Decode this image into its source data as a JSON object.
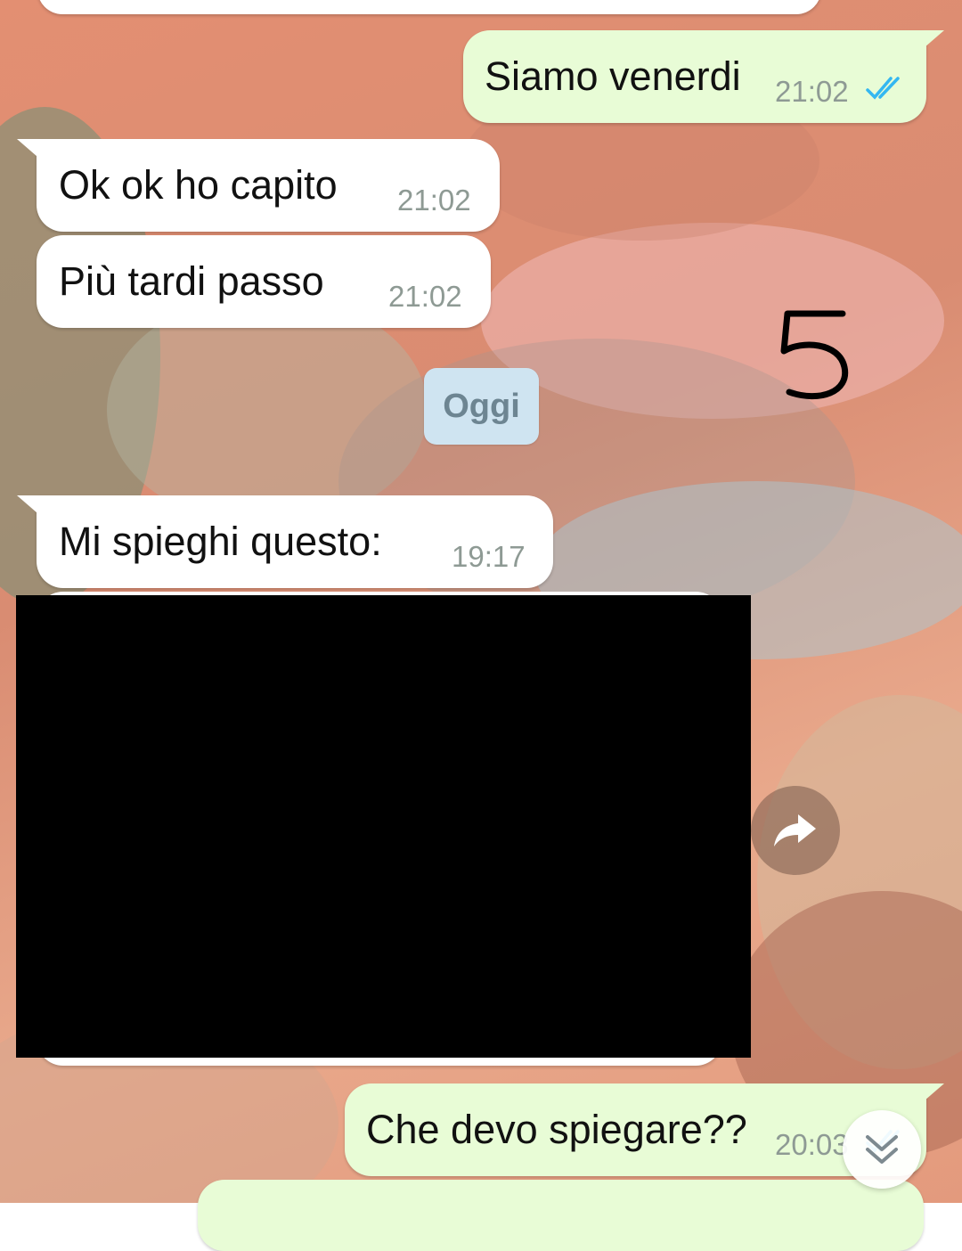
{
  "wallpaper": {
    "description": "abstract painted pattern"
  },
  "annotation": {
    "text": "5"
  },
  "messages": [
    {
      "direction": "outgoing",
      "text": "Siamo venerdi",
      "time": "21:02",
      "status": "read"
    },
    {
      "direction": "incoming",
      "text": "Ok ok ho capito",
      "time": "21:02"
    },
    {
      "direction": "incoming",
      "text": "Più tardi passo",
      "time": "21:02"
    },
    {
      "direction": "incoming",
      "text": "Mi spieghi questo:",
      "time": "19:17"
    },
    {
      "direction": "outgoing",
      "text": "Che devo spiegare??",
      "time": "20:03",
      "status": "read"
    }
  ],
  "date_separator": {
    "label": "Oggi"
  },
  "media": {
    "redacted": true
  },
  "icons": {
    "read_receipt": "double-check-icon",
    "forward": "forward-arrow-icon",
    "scroll": "chevron-double-down-icon"
  },
  "colors": {
    "incoming_bubble": "#ffffff",
    "outgoing_bubble": "#e8fcd6",
    "date_chip": "#cfe4f1",
    "read_tick": "#34b7f1",
    "timestamp": "#8e9a94"
  }
}
